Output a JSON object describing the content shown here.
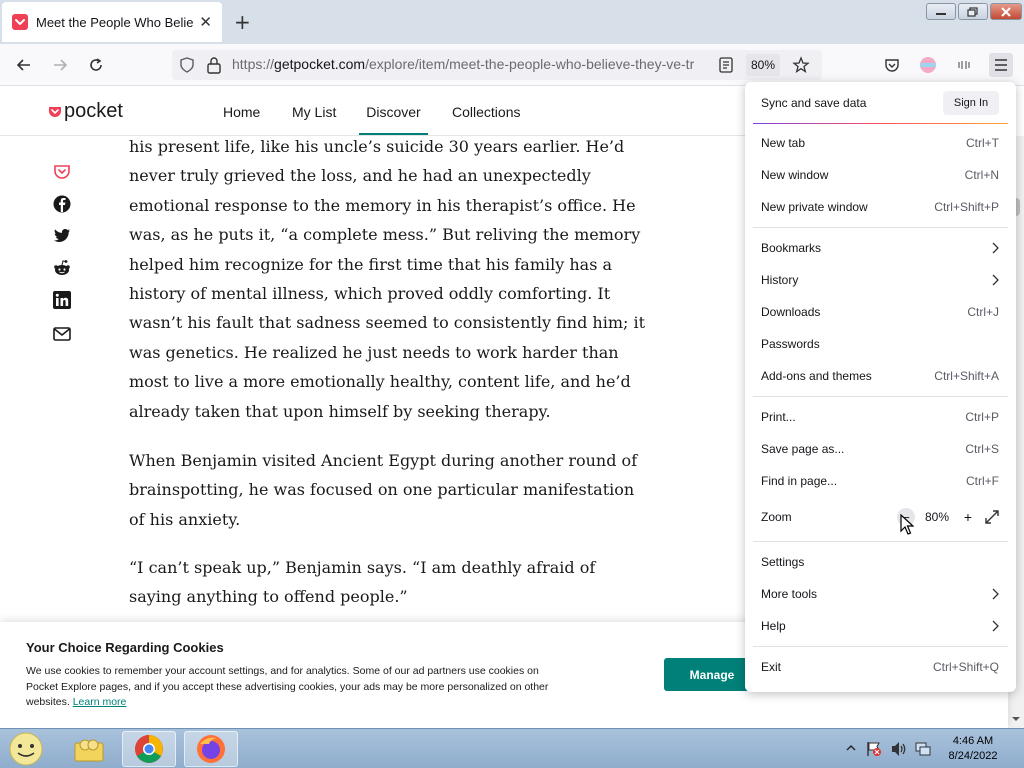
{
  "browser": {
    "tab_title": "Meet the People Who Believe They've Traveled Back in Time",
    "url_scheme": "https://",
    "url_host": "getpocket.com",
    "url_path": "/explore/item/meet-the-people-who-believe-they-ve-tr",
    "zoom_badge": "80%",
    "icons": [
      "pocket-favicon",
      "new-tab-plus",
      "back-arrow",
      "forward-arrow",
      "reload",
      "shield",
      "lock",
      "reader-view",
      "star",
      "pocket",
      "account",
      "extensions",
      "hamburger-menu"
    ]
  },
  "pocket": {
    "logo": "pocket",
    "nav": [
      "Home",
      "My List",
      "Discover",
      "Collections"
    ],
    "active_nav": "Discover",
    "share_icons": [
      "pocket",
      "facebook",
      "twitter",
      "reddit",
      "linkedin",
      "email"
    ]
  },
  "article": {
    "paragraphs": [
      "his present life, like his uncle’s suicide 30 years earlier. He’d never truly grieved the loss, and he had an unexpectedly emotional response to the memory in his therapist’s office. He was, as he puts it, “a complete mess.” But reliving the memory helped him recognize for the first time that his family has a history of mental illness, which proved oddly comforting. It wasn’t his fault that sadness seemed to consistently find him; it was genetics. He realized he just needs to work harder than most to live a more emotionally healthy, content life, and he’d already taken that upon himself by seeking therapy.",
      "When Benjamin visited Ancient Egypt during another round of brainspotting, he was focused on one particular manifestation of his anxiety.",
      "“I can’t speak up,” Benjamin says. “I am deathly afraid of saying anything to offend people.”"
    ]
  },
  "cookie": {
    "title": "Your Choice Regarding Cookies",
    "body": "We use cookies to remember your account settings, and for analytics. Some of our ad partners use cookies on Pocket Explore pages, and if you accept these advertising cookies, your ads may be more personalized on other websites.",
    "learn_more": "Learn more",
    "manage": "Manage"
  },
  "menu": {
    "sync": "Sync and save data",
    "sign_in": "Sign In",
    "items": [
      {
        "label": "New tab",
        "shortcut": "Ctrl+T"
      },
      {
        "label": "New window",
        "shortcut": "Ctrl+N"
      },
      {
        "label": "New private window",
        "shortcut": "Ctrl+Shift+P"
      },
      {
        "label": "Bookmarks",
        "shortcut": ""
      },
      {
        "label": "History",
        "shortcut": ""
      },
      {
        "label": "Downloads",
        "shortcut": "Ctrl+J"
      },
      {
        "label": "Passwords",
        "shortcut": ""
      },
      {
        "label": "Add-ons and themes",
        "shortcut": "Ctrl+Shift+A"
      },
      {
        "label": "Print...",
        "shortcut": "Ctrl+P"
      },
      {
        "label": "Save page as...",
        "shortcut": "Ctrl+S"
      },
      {
        "label": "Find in page...",
        "shortcut": "Ctrl+F"
      },
      {
        "label": "Zoom",
        "shortcut": ""
      },
      {
        "label": "Settings",
        "shortcut": ""
      },
      {
        "label": "More tools",
        "shortcut": ""
      },
      {
        "label": "Help",
        "shortcut": ""
      },
      {
        "label": "Exit",
        "shortcut": "Ctrl+Shift+Q"
      }
    ],
    "zoom_value": "80%",
    "zoom_minus": "−",
    "zoom_plus": "+"
  },
  "taskbar": {
    "time": "4:46 AM",
    "date": "8/24/2022"
  },
  "colors": {
    "pocket_red": "#ef4056",
    "pocket_teal": "#008078",
    "tab_strip": "#d7dfe9"
  }
}
